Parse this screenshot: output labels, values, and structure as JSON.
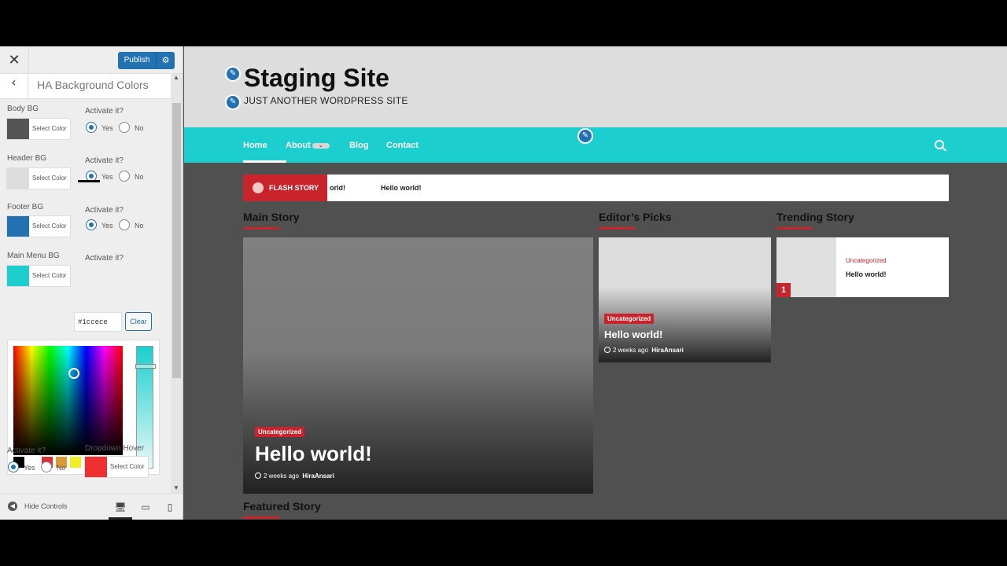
{
  "panel": {
    "close_glyph": "✕",
    "publish_label": "Publish",
    "publish_gear": "⚙",
    "back_glyph": "‹",
    "section_title": "HA Background Colors",
    "rows": [
      {
        "label": "Body BG",
        "activate": "Activate it?",
        "select": "Select Color",
        "yes": "Yes",
        "no": "No",
        "color": "#555555"
      },
      {
        "label": "Header BG",
        "activate": "Activate it?",
        "select": "Select Color",
        "yes": "Yes",
        "no": "No",
        "color": "#dddddd"
      },
      {
        "label": "Footer BG",
        "activate": "Activate it?",
        "select": "Select Color",
        "yes": "Yes",
        "no": "No",
        "color": "#2271b1"
      },
      {
        "label": "Main Menu BG",
        "activate": "Activate it?",
        "select": "Select Color",
        "color": "#1ccece"
      }
    ],
    "hex_value": "#1ccece",
    "clear_label": "Clear",
    "palette": [
      "#000000",
      "#ffffff",
      "#dd3333",
      "#dd9933",
      "#eeee22",
      "#81d742",
      "#1e73be",
      "#8224e3"
    ],
    "bottom_activate": {
      "label": "Activate it?",
      "yes": "Yes",
      "no": "No"
    },
    "dropdown_hover": {
      "label": "Dropdown Hover",
      "select": "Select Color",
      "color": "#f03030"
    },
    "hide_controls": "Hide Controls",
    "hide_glyph": "◀",
    "devices": [
      "🖥",
      "▭",
      "▯"
    ]
  },
  "site": {
    "edit_glyph": "✎",
    "title": "Staging Site",
    "tagline": "JUST ANOTHER WORDPRESS SITE",
    "nav": [
      "Home",
      "About",
      "Blog",
      "Contact"
    ],
    "nav_chevron": "⌄",
    "accent": "#1ccece",
    "flash_label": "FLASH STORY",
    "flash_items": [
      "orld!",
      "Hello world!"
    ],
    "columns": [
      "Main Story",
      "Editor’s Picks",
      "Trending Story"
    ],
    "featured": "Featured Story",
    "main": {
      "category": "Uncategorized",
      "headline": "Hello world!",
      "time": "2 weeks ago",
      "author": "HiraAnsari"
    },
    "editor": {
      "category": "Uncategorized",
      "headline": "Hello world!",
      "time": "2 weeks ago",
      "author": "HiraAnsari"
    },
    "trending": {
      "rank": "1",
      "category": "Uncategorized",
      "headline": "Hello world!"
    }
  }
}
